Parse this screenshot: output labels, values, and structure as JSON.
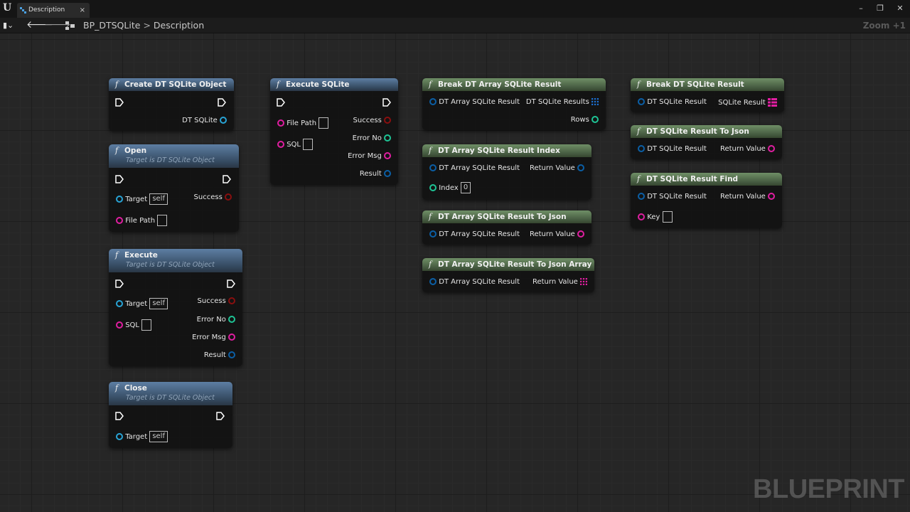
{
  "titlebar": {
    "tab_label": "Description",
    "close_glyph": "×"
  },
  "toolbar": {
    "blueprint_name": "BP_DTSQLite",
    "separator": ">",
    "graph_name": "Description",
    "zoom": "Zoom +1"
  },
  "watermark": "BLUEPRINT",
  "nodes": {
    "create": {
      "title": "Create DT SQLite Object",
      "out_pin": "DT SQLite"
    },
    "open": {
      "title": "Open",
      "subtitle": "Target is DT SQLite Object",
      "target": "Target",
      "target_default": "self",
      "file_path": "File Path",
      "success": "Success"
    },
    "execute": {
      "title": "Execute",
      "subtitle": "Target is DT SQLite Object",
      "target": "Target",
      "target_default": "self",
      "sql": "SQL",
      "success": "Success",
      "error_no": "Error No",
      "error_msg": "Error Msg",
      "result": "Result"
    },
    "close": {
      "title": "Close",
      "subtitle": "Target is DT SQLite Object",
      "target": "Target",
      "target_default": "self"
    },
    "execute_sqlite": {
      "title": "Execute SQLite",
      "file_path": "File Path",
      "sql": "SQL",
      "success": "Success",
      "error_no": "Error No",
      "error_msg": "Error Msg",
      "result": "Result"
    },
    "break_array": {
      "title": "Break DT Array SQLite Result",
      "in_pin": "DT Array SQLite Result",
      "out_results": "DT SQLite Results",
      "out_rows": "Rows"
    },
    "array_index": {
      "title": "DT Array SQLite Result Index",
      "in_pin": "DT Array SQLite Result",
      "index": "Index",
      "index_default": "0",
      "return": "Return Value"
    },
    "array_to_json": {
      "title": "DT Array SQLite Result To Json",
      "in_pin": "DT Array SQLite Result",
      "return": "Return Value"
    },
    "array_to_json_array": {
      "title": "DT Array SQLite Result To Json Array",
      "in_pin": "DT Array SQLite Result",
      "return": "Return Value"
    },
    "break_result": {
      "title": "Break DT SQLite Result",
      "in_pin": "DT SQLite Result",
      "out_pin": "SQLite Result"
    },
    "result_to_json": {
      "title": "DT SQLite Result To Json",
      "in_pin": "DT SQLite Result",
      "return": "Return Value"
    },
    "result_find": {
      "title": "DT SQLite Result Find",
      "in_pin": "DT SQLite Result",
      "key": "Key",
      "return": "Return Value"
    }
  },
  "colors": {
    "object_pin": "#28a4d6",
    "struct_pin": "#0b5fa6",
    "string_pin": "#e01ea1",
    "int_pin": "#1ec596",
    "bool_pin": "#8a0f0f",
    "function_header": "#34495f",
    "pure_header": "#44593f"
  }
}
